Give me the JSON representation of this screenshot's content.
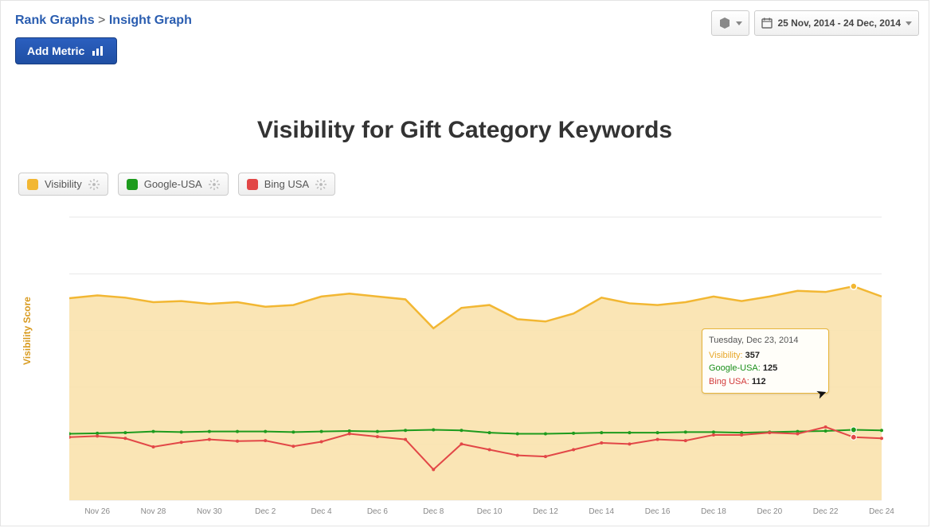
{
  "breadcrumb": {
    "parent": "Rank Graphs",
    "sep": ">",
    "current": "Insight Graph"
  },
  "buttons": {
    "add_metric": "Add Metric"
  },
  "date_range": "25 Nov, 2014 - 24 Dec, 2014",
  "chart": {
    "title": "Visibility for Gift Category Keywords",
    "yaxis_title": "Visibility Score",
    "legend": {
      "visibility": {
        "label": "Visibility",
        "color": "#f2b733"
      },
      "google": {
        "label": "Google-USA",
        "color": "#1d9b1d"
      },
      "bing": {
        "label": "Bing USA",
        "color": "#e24747"
      }
    }
  },
  "tooltip": {
    "date": "Tuesday, Dec 23, 2014",
    "rows": {
      "visibility": {
        "label": "Visibility:",
        "value": "357"
      },
      "google": {
        "label": "Google-USA:",
        "value": "125"
      },
      "bing": {
        "label": "Bing USA:",
        "value": "112"
      }
    }
  },
  "chart_data": {
    "type": "line",
    "title": "Visibility for Gift Category Keywords",
    "xlabel": "",
    "ylabel": "Visibility Score",
    "ylim": [
      1,
      500
    ],
    "yticks": [
      1,
      100,
      200,
      300,
      400,
      500
    ],
    "x": [
      "Nov 25",
      "Nov 26",
      "Nov 27",
      "Nov 28",
      "Nov 29",
      "Nov 30",
      "Dec 1",
      "Dec 2",
      "Dec 3",
      "Dec 4",
      "Dec 5",
      "Dec 6",
      "Dec 7",
      "Dec 8",
      "Dec 9",
      "Dec 10",
      "Dec 11",
      "Dec 12",
      "Dec 13",
      "Dec 14",
      "Dec 15",
      "Dec 16",
      "Dec 17",
      "Dec 18",
      "Dec 19",
      "Dec 20",
      "Dec 21",
      "Dec 22",
      "Dec 23",
      "Dec 24"
    ],
    "xticks": [
      "Nov 26",
      "Nov 28",
      "Nov 30",
      "Dec 2",
      "Dec 4",
      "Dec 6",
      "Dec 8",
      "Dec 10",
      "Dec 12",
      "Dec 14",
      "Dec 16",
      "Dec 18",
      "Dec 20",
      "Dec 22",
      "Dec 24"
    ],
    "series": [
      {
        "name": "Visibility",
        "color": "#f2b733",
        "area": true,
        "values": [
          357,
          362,
          358,
          350,
          352,
          347,
          350,
          342,
          345,
          360,
          365,
          360,
          355,
          304,
          340,
          345,
          320,
          316,
          330,
          358,
          348,
          345,
          350,
          360,
          352,
          360,
          370,
          368,
          378,
          360
        ]
      },
      {
        "name": "Google-USA",
        "color": "#1d9b1d",
        "values": [
          118,
          119,
          120,
          122,
          121,
          122,
          122,
          122,
          121,
          122,
          123,
          122,
          124,
          125,
          124,
          120,
          118,
          118,
          119,
          120,
          120,
          120,
          121,
          121,
          120,
          121,
          122,
          123,
          125,
          124
        ]
      },
      {
        "name": "Bing USA",
        "color": "#e24747",
        "values": [
          112,
          114,
          110,
          95,
          103,
          108,
          105,
          106,
          96,
          104,
          118,
          113,
          108,
          55,
          100,
          90,
          80,
          78,
          90,
          102,
          100,
          108,
          106,
          116,
          116,
          120,
          118,
          130,
          112,
          110
        ]
      }
    ]
  }
}
